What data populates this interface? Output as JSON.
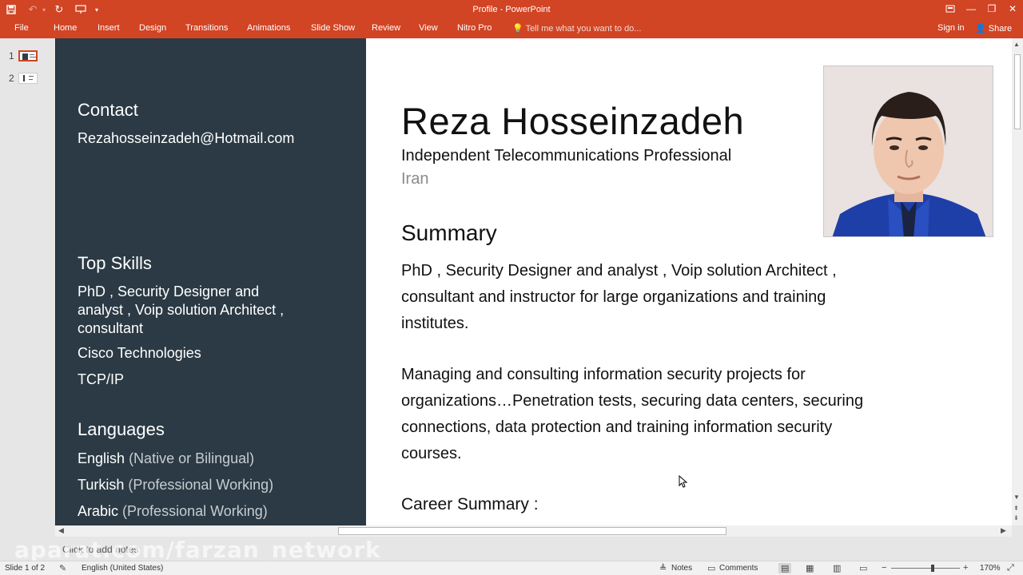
{
  "window": {
    "title": "Profile - PowerPoint"
  },
  "quick_access": {
    "save_icon": "save-icon",
    "undo_icon": "undo-icon",
    "redo_icon": "redo-icon",
    "present_icon": "present-icon",
    "customize_icon": "customize-icon"
  },
  "ribbon": {
    "tabs": [
      "File",
      "Home",
      "Insert",
      "Design",
      "Transitions",
      "Animations",
      "Slide Show",
      "Review",
      "View",
      "Nitro Pro"
    ],
    "tell_me": "Tell me what you want to do...",
    "sign_in": "Sign in",
    "share": "Share"
  },
  "thumbnails": [
    {
      "number": "1",
      "selected": true
    },
    {
      "number": "2",
      "selected": false
    }
  ],
  "slide": {
    "contact_heading": "Contact",
    "email": "Rezahosseinzadeh@Hotmail.com",
    "skills_heading": "Top Skills",
    "skills": [
      "PhD , Security Designer and\nanalyst , Voip solution  Architect ,\nconsultant",
      "Cisco Technologies",
      "TCP/IP"
    ],
    "languages_heading": "Languages",
    "languages": [
      {
        "name": "English",
        "level": "(Native or Bilingual)"
      },
      {
        "name": "Turkish",
        "level": "(Professional Working)"
      },
      {
        "name": "Arabic",
        "level": "(Professional Working)"
      }
    ],
    "name": "Reza Hosseinzadeh",
    "headline": "Independent Telecommunications Professional",
    "location": "Iran",
    "summary_heading": "Summary",
    "summary_p1": "PhD , Security Designer and analyst , Voip solution  Architect ,\nconsultant and instructor for large organizations and training\ninstitutes.",
    "summary_p2": "Managing and consulting information security projects for\norganizations…Penetration tests, securing data centers, securing\nconnections, data protection and training information security\ncourses.",
    "career_heading": "Career Summary :"
  },
  "notes": {
    "placeholder": "Click to add notes"
  },
  "watermark": "aparat.com/farzan_network",
  "status": {
    "slide_info": "Slide 1 of 2",
    "language": "English (United States)",
    "notes": "Notes",
    "comments": "Comments",
    "zoom": "170%"
  },
  "colors": {
    "accent": "#d14424",
    "sidebar": "#2b3a44"
  }
}
